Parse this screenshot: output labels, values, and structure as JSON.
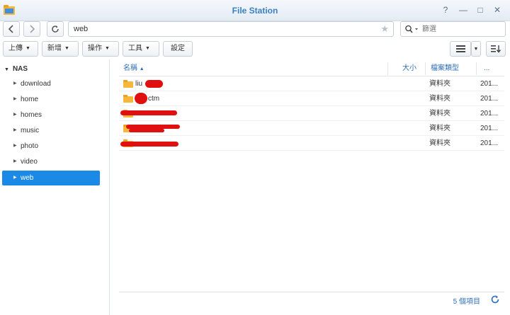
{
  "window": {
    "title": "File Station",
    "help": "?",
    "minimize": "—",
    "maximize": "□",
    "close": "✕"
  },
  "nav": {
    "back": "‹",
    "forward": "›",
    "path": "web",
    "search_placeholder": "篩選"
  },
  "toolbar": {
    "upload": "上傳",
    "create": "新增",
    "action": "操作",
    "tools": "工具",
    "settings": "設定"
  },
  "sidebar": {
    "root": "NAS",
    "items": [
      {
        "label": "download"
      },
      {
        "label": "home"
      },
      {
        "label": "homes"
      },
      {
        "label": "music"
      },
      {
        "label": "photo"
      },
      {
        "label": "video"
      },
      {
        "label": "web"
      }
    ],
    "active": "web"
  },
  "columns": {
    "name": "名稱",
    "size": "大小",
    "type": "檔案類型",
    "more": "..."
  },
  "files": [
    {
      "name": "liu",
      "type": "資料夾",
      "date": "201..."
    },
    {
      "name": "ctm",
      "type": "資料夾",
      "date": "201..."
    },
    {
      "name": "",
      "type": "資料夾",
      "date": "201..."
    },
    {
      "name": "",
      "type": "資料夾",
      "date": "201..."
    },
    {
      "name": "",
      "type": "資料夾",
      "date": "201..."
    }
  ],
  "footer": {
    "count": "5 個項目"
  },
  "colors": {
    "accent": "#1a8ae6",
    "header_text": "#2f6fb7",
    "folder": "#f5b83a",
    "redaction": "#e01010"
  },
  "icons": {
    "app": "folder-icon",
    "search": "search-icon",
    "refresh": "refresh-icon",
    "list_view": "list-view-icon",
    "sort": "sort-icon"
  }
}
